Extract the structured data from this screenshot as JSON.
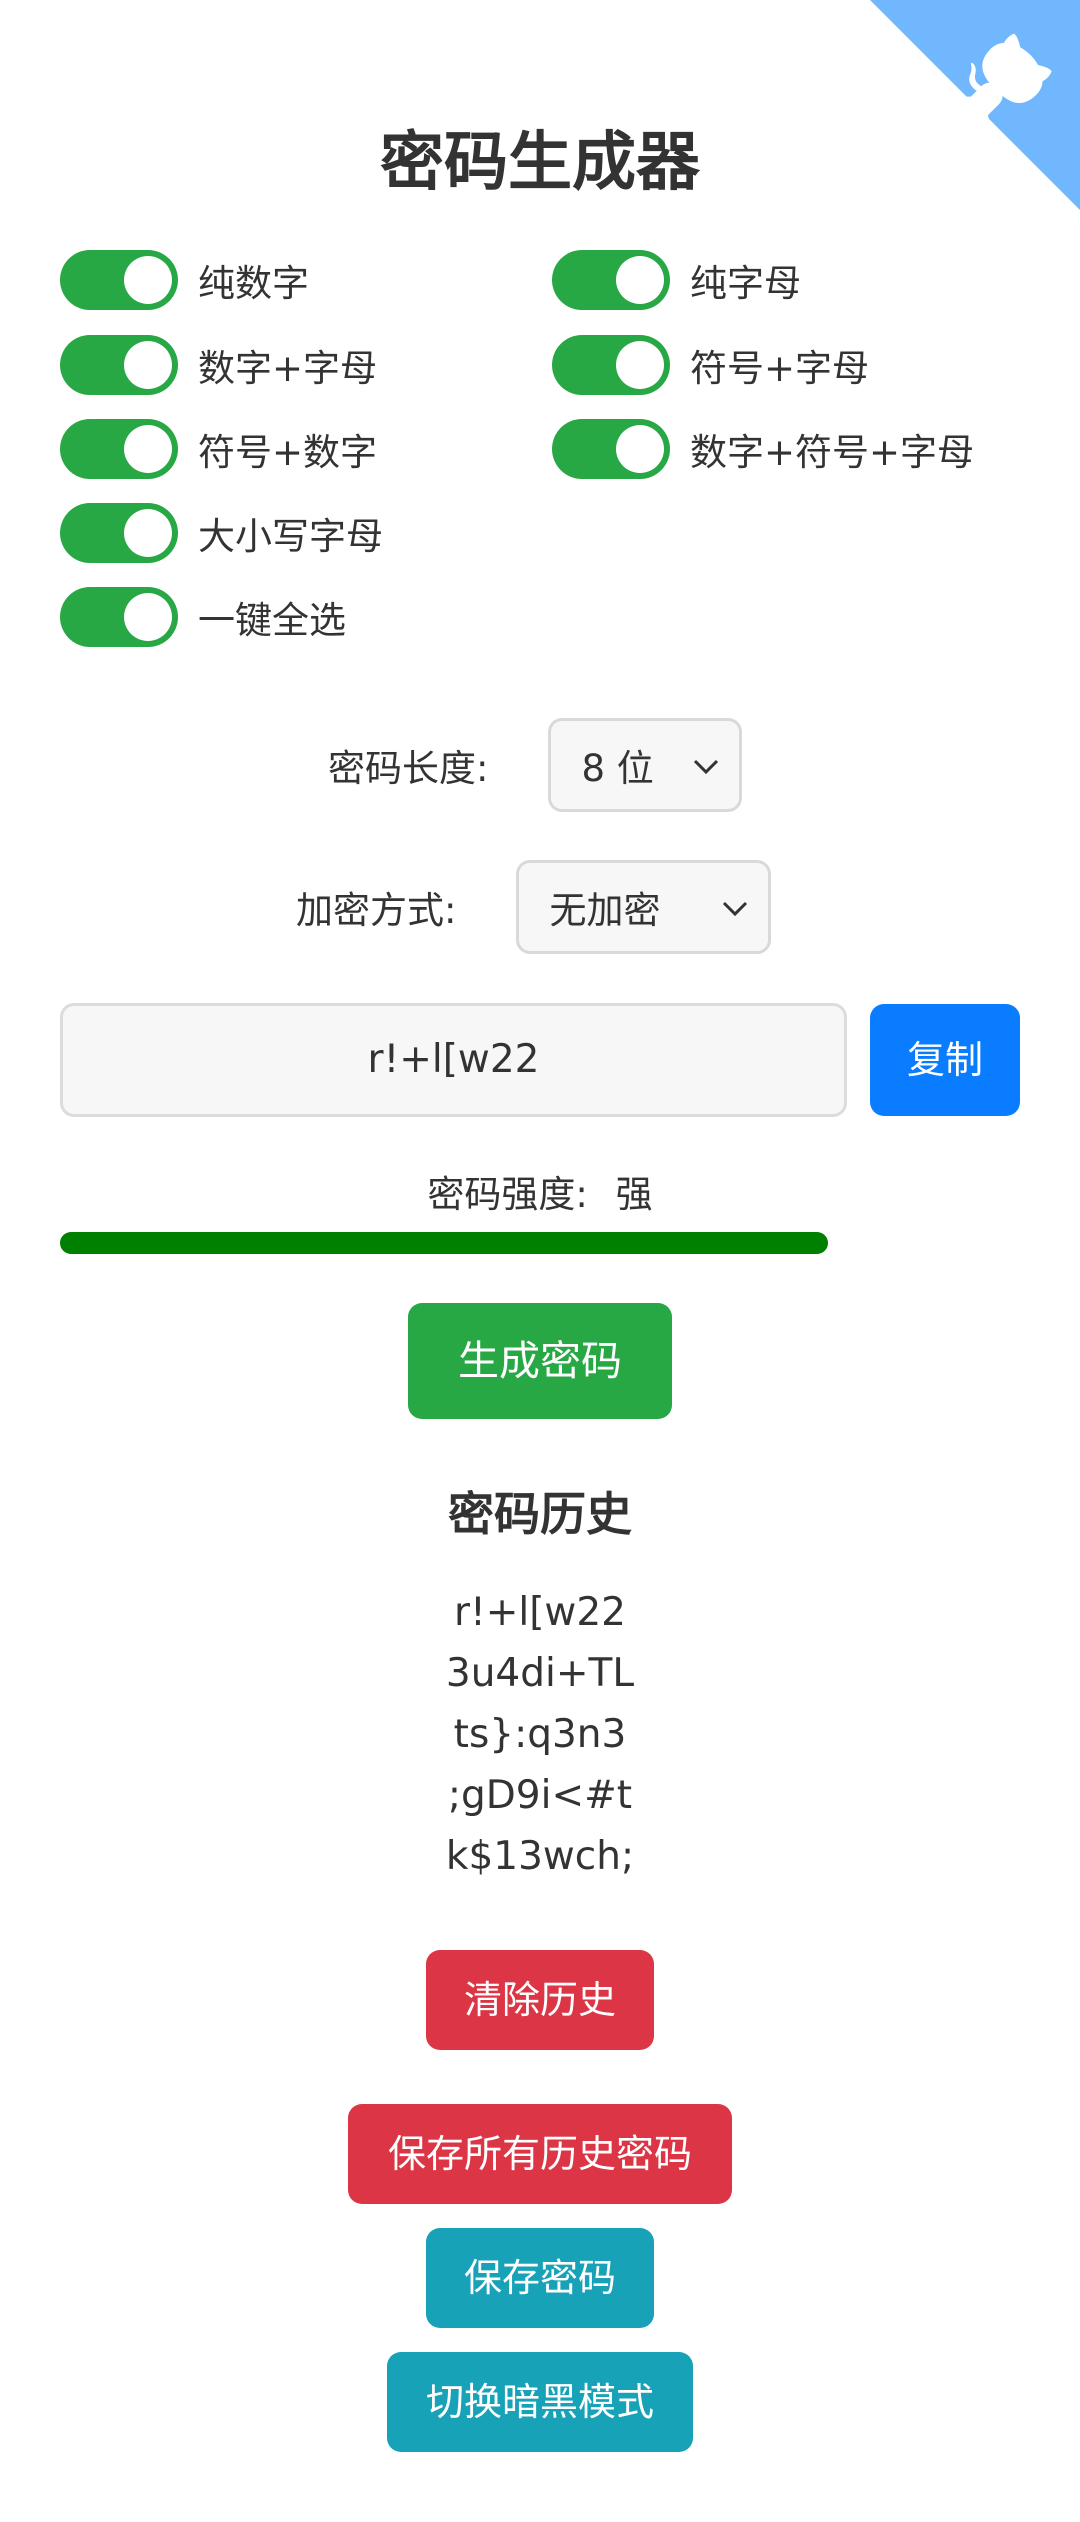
{
  "header": {
    "title": "密码生成器",
    "github_icon": "github-octocat-icon",
    "corner_color": "#70b7fd"
  },
  "options": [
    {
      "label": "纯数字",
      "checked": true
    },
    {
      "label": "纯字母",
      "checked": true
    },
    {
      "label": "数字+字母",
      "checked": true
    },
    {
      "label": "符号+字母",
      "checked": true
    },
    {
      "label": "符号+数字",
      "checked": true
    },
    {
      "label": "数字+符号+字母",
      "checked": true
    },
    {
      "label": "大小写字母",
      "checked": true
    },
    {
      "label": "一键全选",
      "checked": true
    }
  ],
  "length": {
    "label": "密码长度:",
    "value": "8 位"
  },
  "encryption": {
    "label": "加密方式:",
    "value": "无加密"
  },
  "password": {
    "value": "r!+l[w22",
    "copy_label": "复制"
  },
  "strength": {
    "label": "密码强度:",
    "value": "强",
    "color": "#008000",
    "level": 1.0
  },
  "generate_label": "生成密码",
  "history": {
    "title": "密码历史",
    "items": [
      "r!+l[w22",
      "3u4di+TL",
      "ts}:q3n3",
      ";gD9i<#t",
      "k$13wch;"
    ]
  },
  "actions": {
    "clear_history": "清除历史",
    "save_all_history": "保存所有历史密码",
    "save_password": "保存密码",
    "toggle_dark_mode": "切换暗黑模式"
  },
  "colors": {
    "toggle_on": "#28a745",
    "copy_button": "#0a7cff",
    "danger": "#dc3545",
    "info": "#17a2b8"
  }
}
